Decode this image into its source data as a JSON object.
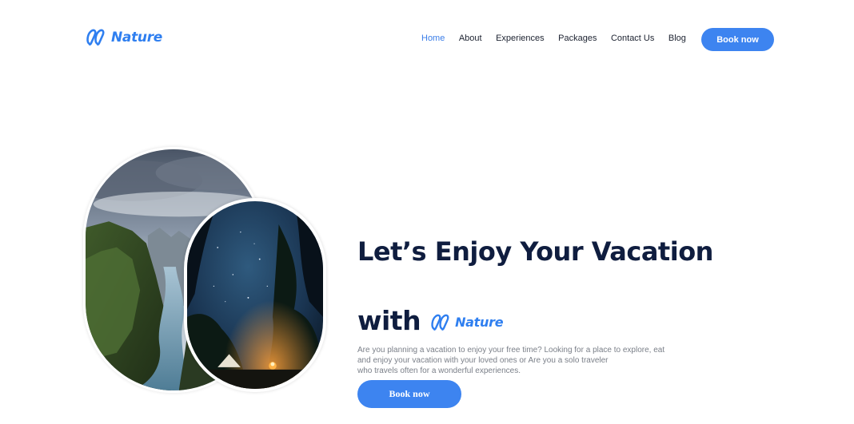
{
  "brand": {
    "name": "Nature",
    "color": "#2f7ff0",
    "icon": "infinity-logo-icon"
  },
  "nav": {
    "items": [
      {
        "label": "Home",
        "active": true
      },
      {
        "label": "About",
        "active": false
      },
      {
        "label": "Experiences",
        "active": false
      },
      {
        "label": "Packages",
        "active": false
      },
      {
        "label": "Contact Us",
        "active": false
      },
      {
        "label": "Blog",
        "active": false
      }
    ],
    "cta_label": "Book now"
  },
  "hero": {
    "headline": "Let’s Enjoy Your Vacation",
    "with_word": "with",
    "with_brand": "Nature",
    "description_lines": [
      "Are you planning a vacation to enjoy your free time? Looking for a place to explore, eat",
      "and enjoy your vacation with your loved ones or Are you a solo traveler",
      "who travels often for a wonderful experiences."
    ],
    "cta_label": "Book now",
    "images": [
      {
        "name": "canyon-river-photo"
      },
      {
        "name": "night-camping-photo"
      }
    ]
  },
  "colors": {
    "accent": "#3d84f0",
    "headline": "#0f1d3f",
    "body_text": "#7a7f88"
  }
}
